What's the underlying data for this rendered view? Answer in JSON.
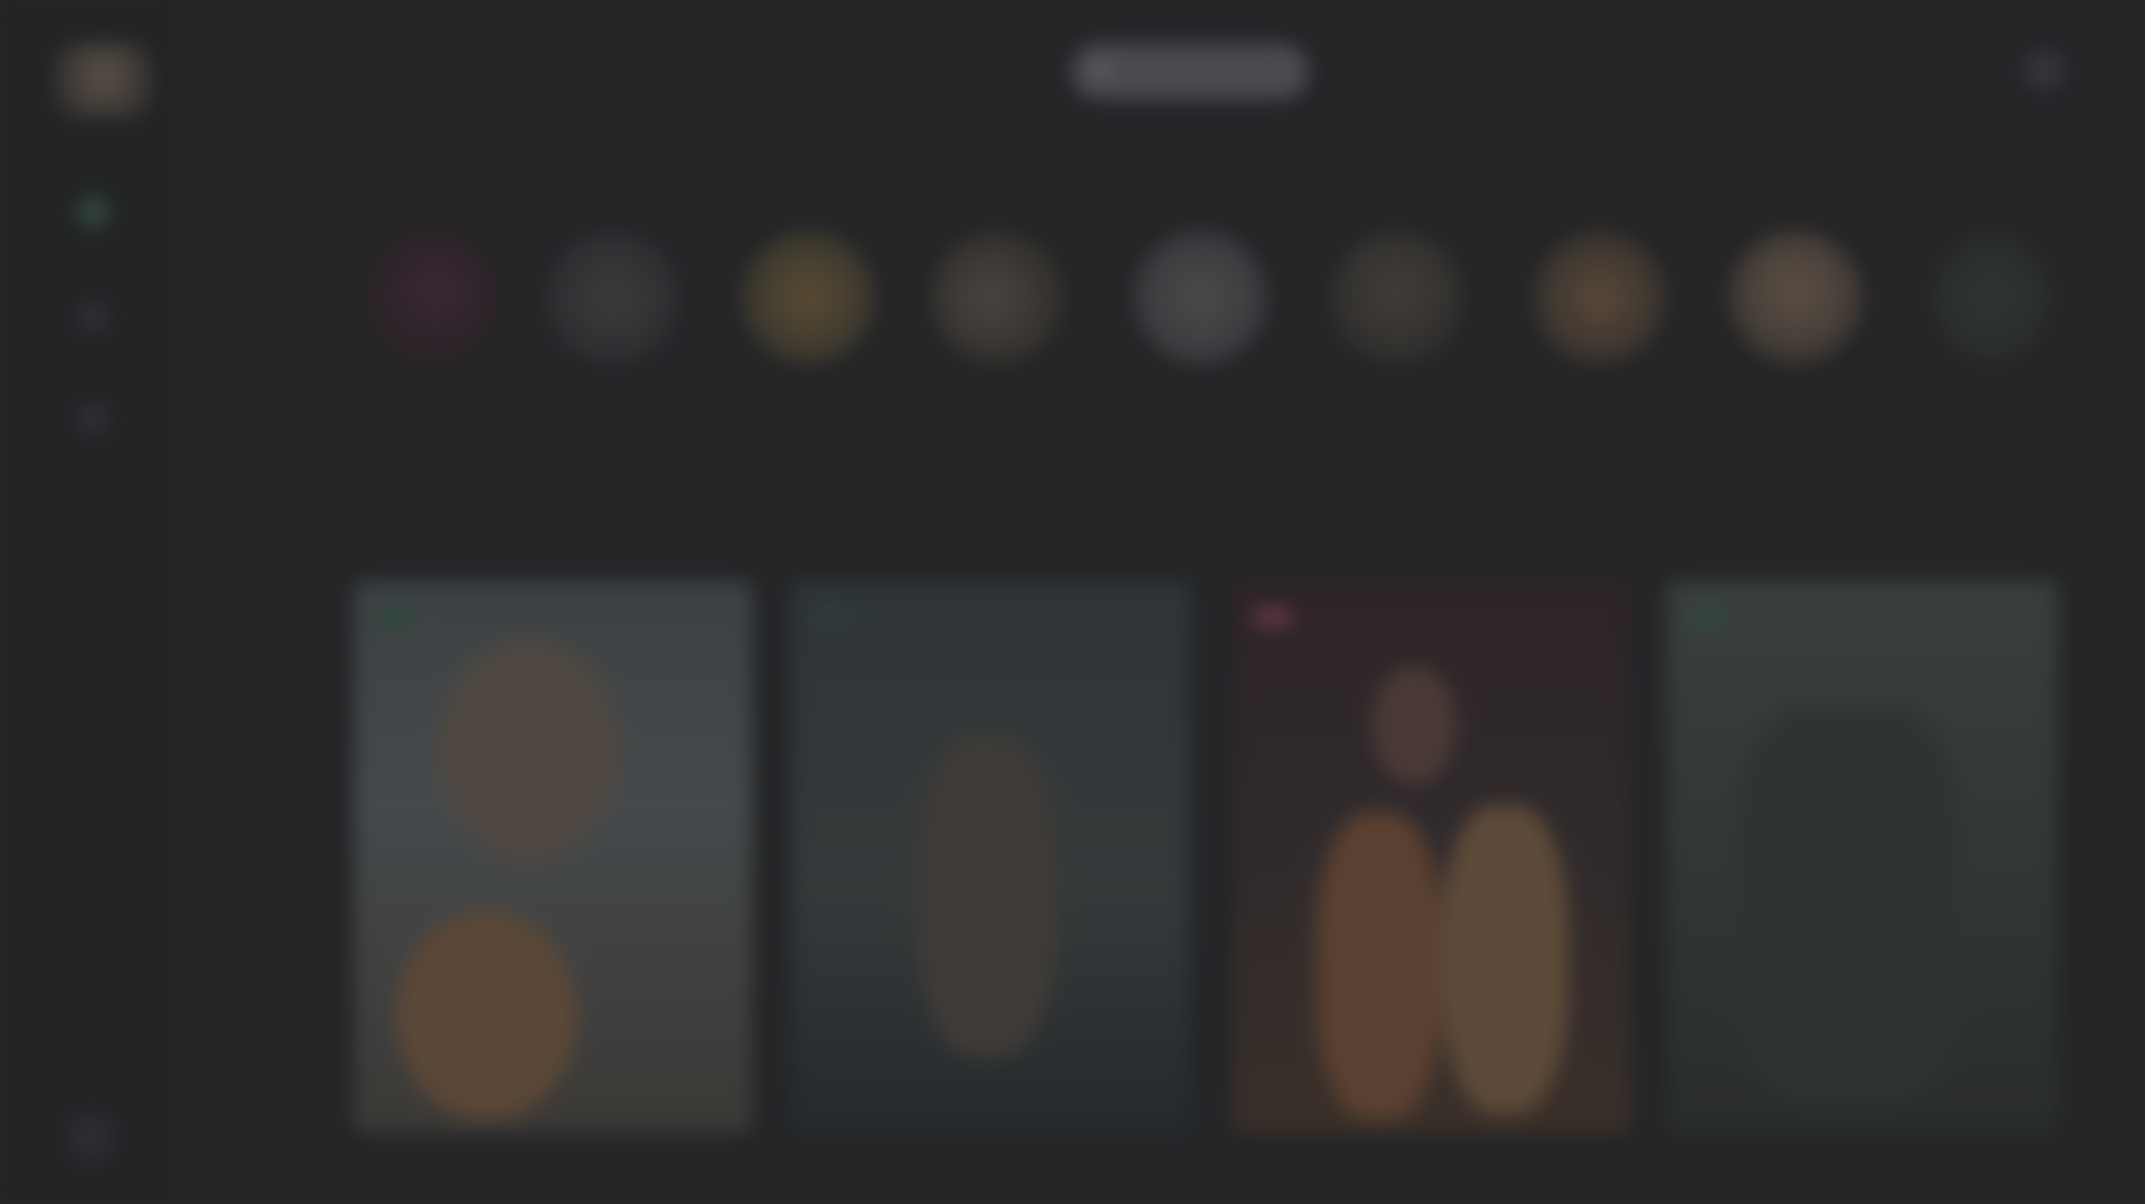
{
  "search": {
    "placeholder": "",
    "icon": "search-icon"
  },
  "sidebar": {
    "items": [
      {
        "icon": "home-icon"
      },
      {
        "icon": "grid-icon"
      },
      {
        "icon": "user-icon"
      }
    ],
    "bottom_icon": "settings-icon"
  },
  "categories": [
    {
      "label": ""
    },
    {
      "label": ""
    },
    {
      "label": ""
    },
    {
      "label": ""
    },
    {
      "label": ""
    },
    {
      "label": ""
    },
    {
      "label": ""
    },
    {
      "label": ""
    },
    {
      "label": ""
    }
  ],
  "section": {
    "title": "",
    "more": ""
  },
  "cards": [
    {
      "badge": "",
      "title": "",
      "badge_color": "#2e4a3e"
    },
    {
      "badge": "",
      "title": "",
      "badge_color": "#2e3c40"
    },
    {
      "badge": "",
      "title": "",
      "badge_color": "#6a3a4a"
    },
    {
      "badge": "",
      "title": "",
      "badge_color": "#2e4a3e"
    }
  ],
  "colors": {
    "background": "#242527",
    "sidebar": "#222325",
    "accent_green": "#33463e",
    "accent_pink": "#6a3a4a"
  }
}
